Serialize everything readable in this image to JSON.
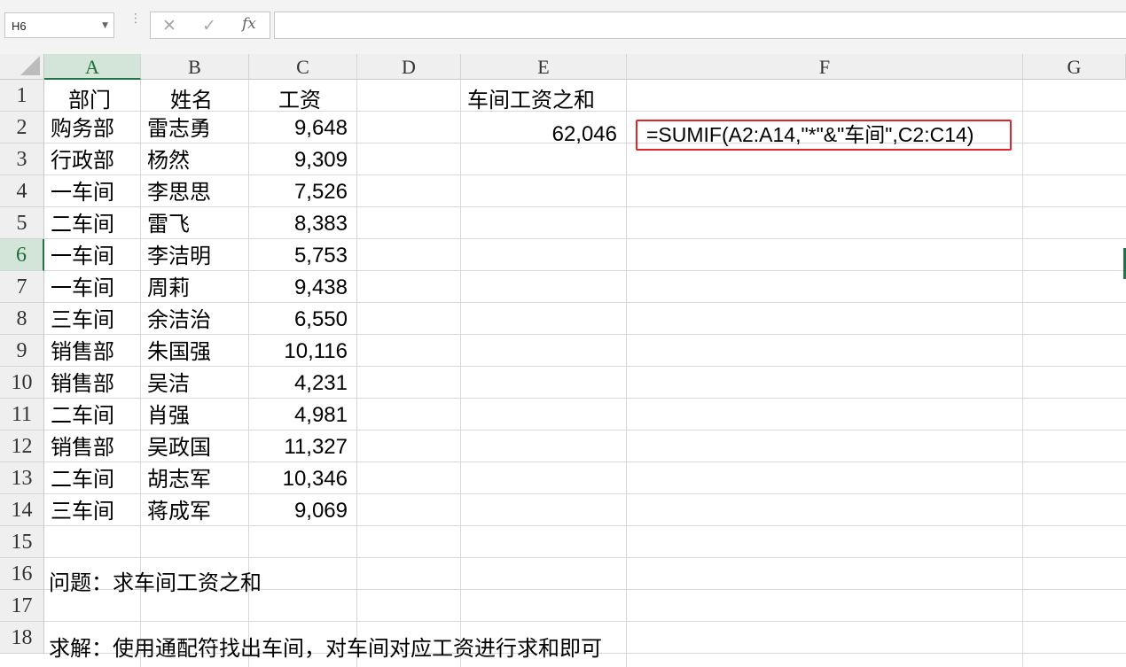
{
  "formula_bar": {
    "name_box": "H6",
    "cancel_icon": "✕",
    "enter_icon": "✓",
    "fx_label": "fx",
    "formula": ""
  },
  "columns": [
    "A",
    "B",
    "C",
    "D",
    "E",
    "F",
    "G"
  ],
  "rows": [
    "1",
    "2",
    "3",
    "4",
    "5",
    "6",
    "7",
    "8",
    "9",
    "10",
    "11",
    "12",
    "13",
    "14",
    "15",
    "16",
    "17",
    "18"
  ],
  "selected_cell": {
    "column": "A",
    "row": "6"
  },
  "header_row": {
    "A": "部门",
    "B": "姓名",
    "C": "工资",
    "E": "车间工资之和"
  },
  "data": [
    {
      "dept": "购务部",
      "name": "雷志勇",
      "salary": "9,648"
    },
    {
      "dept": "行政部",
      "name": "杨然",
      "salary": "9,309"
    },
    {
      "dept": "一车间",
      "name": "李思思",
      "salary": "7,526"
    },
    {
      "dept": "二车间",
      "name": "雷飞",
      "salary": "8,383"
    },
    {
      "dept": "一车间",
      "name": "李洁明",
      "salary": "5,753"
    },
    {
      "dept": "一车间",
      "name": "周莉",
      "salary": "9,438"
    },
    {
      "dept": "三车间",
      "name": "余洁治",
      "salary": "6,550"
    },
    {
      "dept": "销售部",
      "name": "朱国强",
      "salary": "10,116"
    },
    {
      "dept": "销售部",
      "name": "吴洁",
      "salary": "4,231"
    },
    {
      "dept": "二车间",
      "name": "肖强",
      "salary": "4,981"
    },
    {
      "dept": "销售部",
      "name": "吴政国",
      "salary": "11,327"
    },
    {
      "dept": "二车间",
      "name": "胡志军",
      "salary": "10,346"
    },
    {
      "dept": "三车间",
      "name": "蒋成军",
      "salary": "9,069"
    }
  ],
  "result_value": "62,046",
  "formula_annotation": "=SUMIF(A2:A14,\"*\"&\"车间\",C2:C14)",
  "question": "问题：求车间工资之和",
  "solution": "求解：使用通配符找出车间，对车间对应工资进行求和即可",
  "colors": {
    "highlight_border": "#e0262d",
    "selection": "#217346",
    "header_bg": "#efefef",
    "grid_line": "#d9d9d9"
  }
}
